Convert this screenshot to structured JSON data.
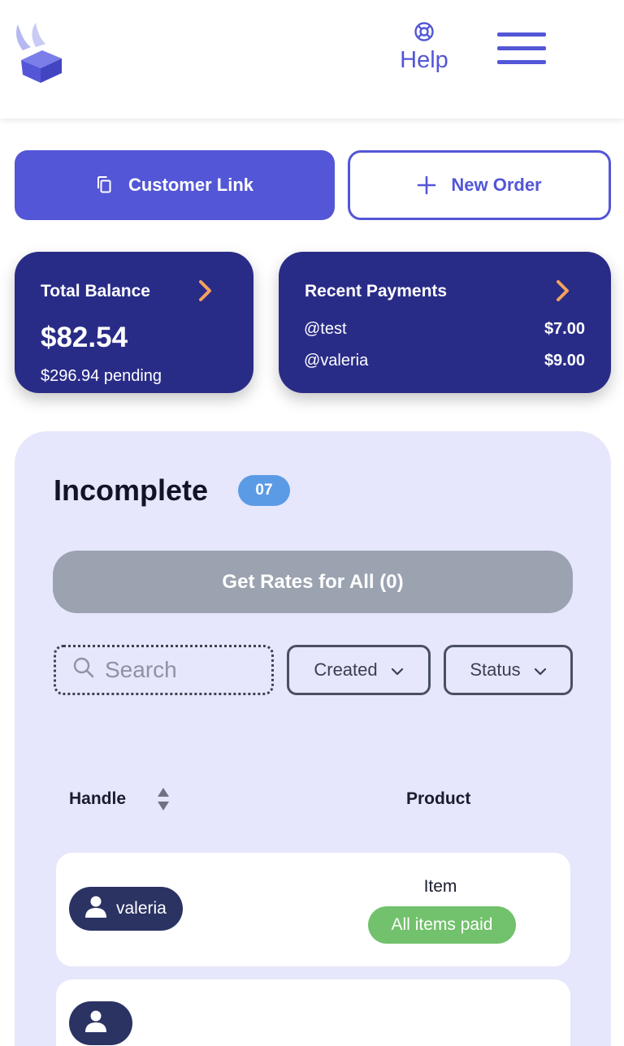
{
  "header": {
    "help_label": "Help"
  },
  "actions": {
    "customer_link_label": "Customer Link",
    "new_order_label": "New Order"
  },
  "balance_card": {
    "title": "Total Balance",
    "amount": "$82.54",
    "pending": "$296.94 pending"
  },
  "payments_card": {
    "title": "Recent Payments",
    "items": [
      {
        "handle": "@test",
        "amount": "$7.00"
      },
      {
        "handle": "@valeria",
        "amount": "$9.00"
      }
    ]
  },
  "incomplete": {
    "title": "Incomplete",
    "count": "07",
    "rates_button_label": "Get Rates for All (0)",
    "search_placeholder": "Search",
    "filters": {
      "created_label": "Created",
      "status_label": "Status"
    },
    "columns": {
      "handle": "Handle",
      "product": "Product"
    },
    "rows": [
      {
        "handle": "valeria",
        "product": "Item",
        "status": "All items paid"
      },
      {
        "handle": "",
        "product": "",
        "status": ""
      }
    ]
  },
  "colors": {
    "accent": "#5356d6",
    "card_bg": "#292c87",
    "panel_bg": "#e6e6fc",
    "badge_blue": "#5b9be6",
    "paid_green": "#72c16c",
    "arrow_orange": "#f5a25d"
  },
  "icons": {
    "logo": "winged-box-logo",
    "help": "lifebuoy-icon",
    "menu": "hamburger-menu-icon",
    "copy": "copy-icon",
    "plus": "plus-icon",
    "chevron_right": "chevron-right-icon",
    "search": "search-icon",
    "chevron_down": "chevron-down-icon",
    "sort": "sort-icon",
    "user": "user-icon"
  }
}
